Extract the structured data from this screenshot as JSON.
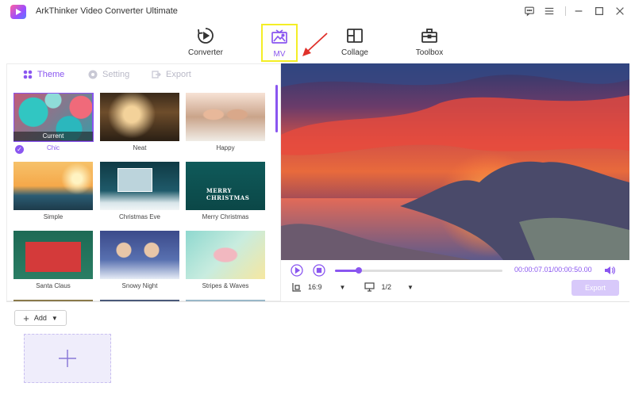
{
  "app": {
    "title": "ArkThinker Video Converter Ultimate"
  },
  "nav": [
    {
      "id": "converter",
      "label": "Converter",
      "icon": "converter-icon",
      "active": false
    },
    {
      "id": "mv",
      "label": "MV",
      "icon": "mv-icon",
      "active": true
    },
    {
      "id": "collage",
      "label": "Collage",
      "icon": "collage-icon",
      "active": false
    },
    {
      "id": "toolbox",
      "label": "Toolbox",
      "icon": "toolbox-icon",
      "active": false
    }
  ],
  "tabs": [
    {
      "id": "theme",
      "label": "Theme",
      "icon": "theme-icon",
      "active": true
    },
    {
      "id": "setting",
      "label": "Setting",
      "icon": "gear-icon",
      "active": false
    },
    {
      "id": "export",
      "label": "Export",
      "icon": "export-icon",
      "active": false
    }
  ],
  "themes": [
    {
      "label": "Chic",
      "current": true,
      "current_text": "Current"
    },
    {
      "label": "Neat"
    },
    {
      "label": "Happy"
    },
    {
      "label": "Simple"
    },
    {
      "label": "Christmas Eve"
    },
    {
      "label": "Merry Christmas",
      "overlay_text": "MERRY CHRISTMAS"
    },
    {
      "label": "Santa Claus"
    },
    {
      "label": "Snowy Night"
    },
    {
      "label": "Stripes & Waves"
    }
  ],
  "player": {
    "current_time": "00:00:07.01",
    "total_time": "00:00:50.00",
    "progress": 0.14,
    "aspect_ratio": "16:9",
    "screen": "1/2",
    "export_label": "Export"
  },
  "bottom": {
    "add_label": "Add"
  },
  "colors": {
    "accent": "#8a56f0",
    "highlight": "#f4ee24",
    "arrow": "#e0312b"
  }
}
